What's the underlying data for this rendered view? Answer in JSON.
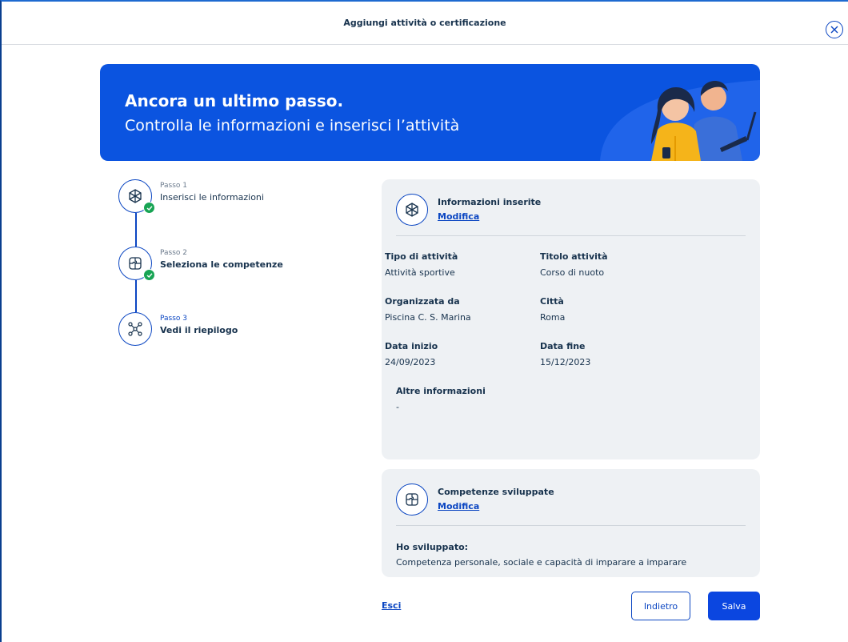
{
  "header": {
    "title": "Aggiungi attività o certificazione",
    "close_icon": "close-circle-icon"
  },
  "banner": {
    "title": "Ancora un ultimo passo.",
    "subtitle": "Controlla le informazioni e inserisci l’attività",
    "illustration": "students-illustration"
  },
  "stepper": {
    "steps": [
      {
        "small": "Passo 1",
        "label": "Inserisci le informazioni",
        "icon": "cube-icon",
        "completed": true
      },
      {
        "small": "Passo 2",
        "label": "Seleziona le competenze",
        "icon": "puzzle-icon",
        "completed": true
      },
      {
        "small": "Passo 3",
        "label": "Vedi il riepilogo",
        "icon": "network-icon",
        "completed": false,
        "active": true
      }
    ]
  },
  "info_card": {
    "heading": "Informazioni inserite",
    "edit_link": "Modifica",
    "icon": "cube-icon",
    "fields": [
      {
        "label": "Tipo di attività",
        "value": "Attività sportive"
      },
      {
        "label": "Titolo attività",
        "value": "Corso di nuoto"
      },
      {
        "label": "Organizzata da",
        "value": "Piscina C. S. Marina"
      },
      {
        "label": "Città",
        "value": "Roma"
      },
      {
        "label": "Data inizio",
        "value": "24/09/2023"
      },
      {
        "label": "Data fine",
        "value": "15/12/2023"
      },
      {
        "label": "Altre informazioni",
        "value": "-"
      }
    ]
  },
  "skills_card": {
    "heading": "Competenze sviluppate",
    "edit_link": "Modifica",
    "icon": "puzzle-icon",
    "label": "Ho sviluppato:",
    "value": "Competenza personale, sociale e capacità di imparare a imparare"
  },
  "footer": {
    "exit": "Esci",
    "back": "Indietro",
    "save": "Salva"
  },
  "colors": {
    "primary": "#0b46c2",
    "banner": "#0b54e0",
    "success": "#18a454",
    "card_bg": "#eef1f4"
  }
}
